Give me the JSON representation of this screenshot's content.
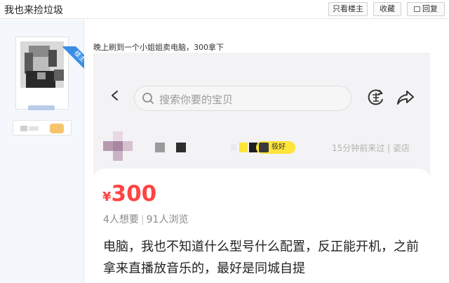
{
  "header": {
    "title": "我也来捡垃圾",
    "buttons": {
      "only_op": "只看楼主",
      "favorite": "收藏",
      "reply": "回复"
    }
  },
  "author": {
    "op_badge": "楼主"
  },
  "post": {
    "text": "晚上刷到一个小姐姐卖电脑，300拿下",
    "screenshot": {
      "search_placeholder": "搜索你要的宝贝",
      "seller": {
        "level_badge": "极好",
        "visit_info": "15分钟前来过 | 姿店"
      },
      "listing": {
        "currency": "¥",
        "price": "300",
        "wants": "4人想要",
        "views": "91人浏览",
        "description": "电脑，我也不知道什么型号什么配置，反正能开机，之前拿来直播放音乐的，最好是同城自提"
      }
    }
  },
  "colors": {
    "price": "#ff4442",
    "op_badge": "#3a8ee6",
    "level_badge": "#ffe43a"
  }
}
